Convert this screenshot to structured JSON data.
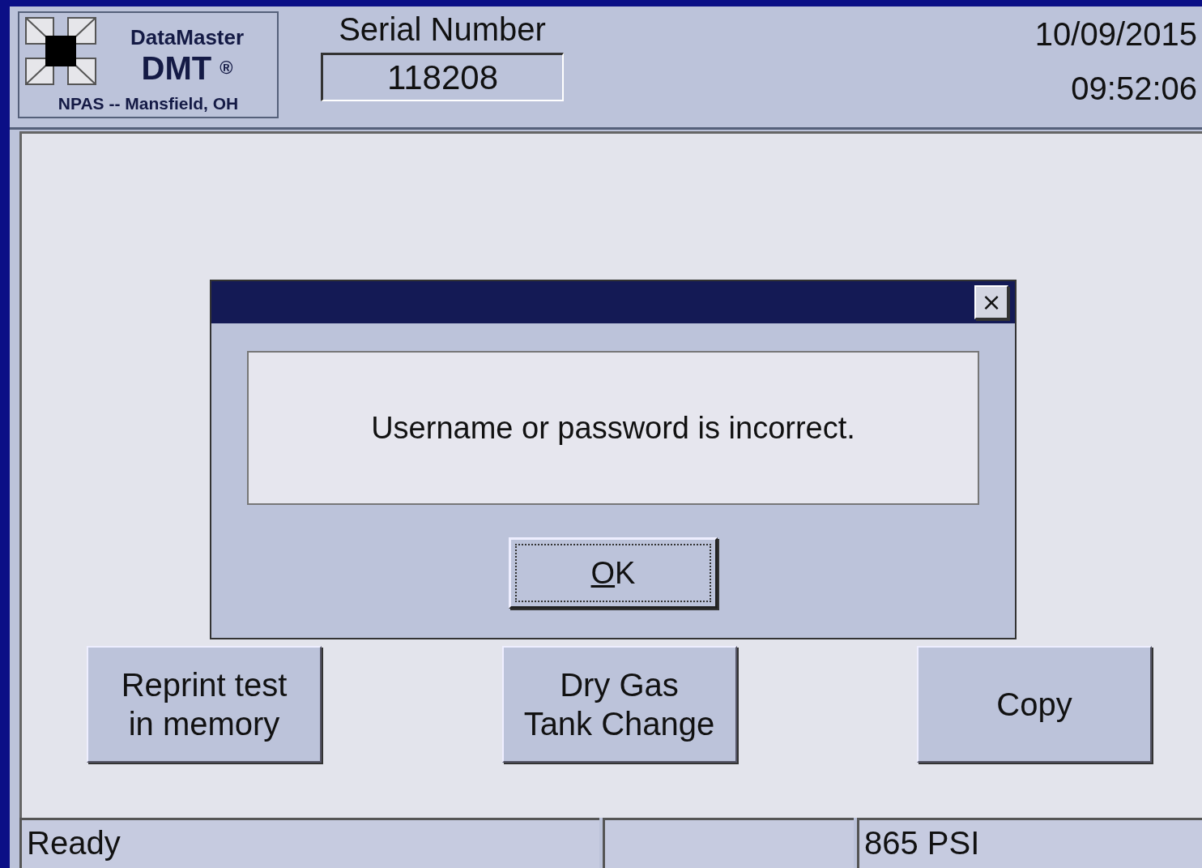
{
  "logo": {
    "title": "DataMaster",
    "model": "DMT",
    "mark": "®",
    "location": "NPAS -- Mansfield, OH"
  },
  "serial": {
    "label": "Serial Number",
    "value": "118208"
  },
  "date": "10/09/2015",
  "time": "09:52:06",
  "dialog": {
    "message": "Username or password is incorrect.",
    "ok": "OK",
    "close": "×"
  },
  "buttons": [
    {
      "lines": [
        "Reprint test",
        "in memory"
      ]
    },
    {
      "lines": [
        "Dry Gas",
        "Tank Change"
      ]
    },
    {
      "lines": [
        "Copy"
      ]
    }
  ],
  "status_bar": {
    "message": "Ready",
    "pressure": "865 PSI"
  }
}
